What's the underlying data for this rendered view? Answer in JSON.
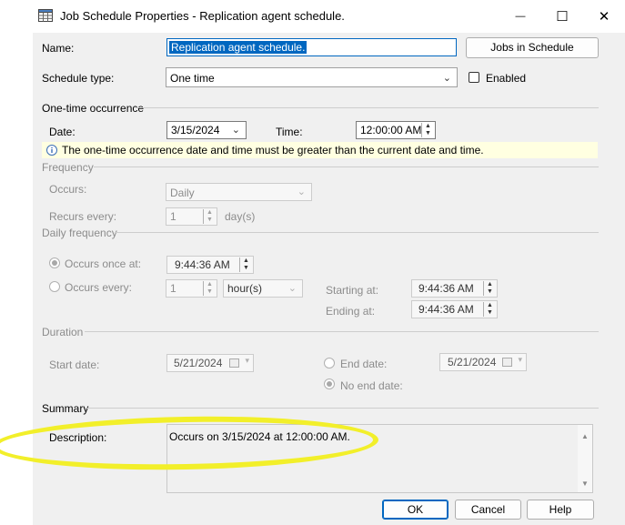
{
  "window": {
    "title": "Job Schedule Properties - Replication agent schedule.",
    "minimize_glyph": "—",
    "maximize_glyph": "☐",
    "close_glyph": "✕"
  },
  "general": {
    "name_label": "Name:",
    "name_value": "Replication agent schedule.",
    "jobs_button": "Jobs in Schedule",
    "schedule_type_label": "Schedule type:",
    "schedule_type_value": "One time",
    "enabled_label": "Enabled",
    "enabled_checked": false
  },
  "one_time": {
    "group_label": "One-time occurrence",
    "date_label": "Date:",
    "date_value": "3/15/2024",
    "time_label": "Time:",
    "time_value": "12:00:00 AM",
    "info_text": "The one-time occurrence date and time must be greater than the current date and time."
  },
  "frequency": {
    "group_label": "Frequency",
    "occurs_label": "Occurs:",
    "occurs_value": "Daily",
    "recurs_label": "Recurs every:",
    "recurs_value": "1",
    "recurs_unit": "day(s)"
  },
  "daily_frequency": {
    "group_label": "Daily frequency",
    "once_label": "Occurs once at:",
    "once_value": "9:44:36 AM",
    "every_label": "Occurs every:",
    "every_value": "1",
    "every_unit": "hour(s)",
    "starting_label": "Starting at:",
    "starting_value": "9:44:36 AM",
    "ending_label": "Ending at:",
    "ending_value": "9:44:36 AM"
  },
  "duration": {
    "group_label": "Duration",
    "start_label": "Start date:",
    "start_value": "5/21/2024",
    "end_label": "End date:",
    "end_value": "5/21/2024",
    "no_end_label": "No end date:"
  },
  "summary": {
    "group_label": "Summary",
    "description_label": "Description:",
    "description_value": "Occurs on 3/15/2024 at 12:00:00 AM."
  },
  "footer": {
    "ok": "OK",
    "cancel": "Cancel",
    "help": "Help"
  },
  "colors": {
    "highlight": "#f2ef2a",
    "selection": "#0067c0",
    "info_background": "#ffffe1"
  }
}
